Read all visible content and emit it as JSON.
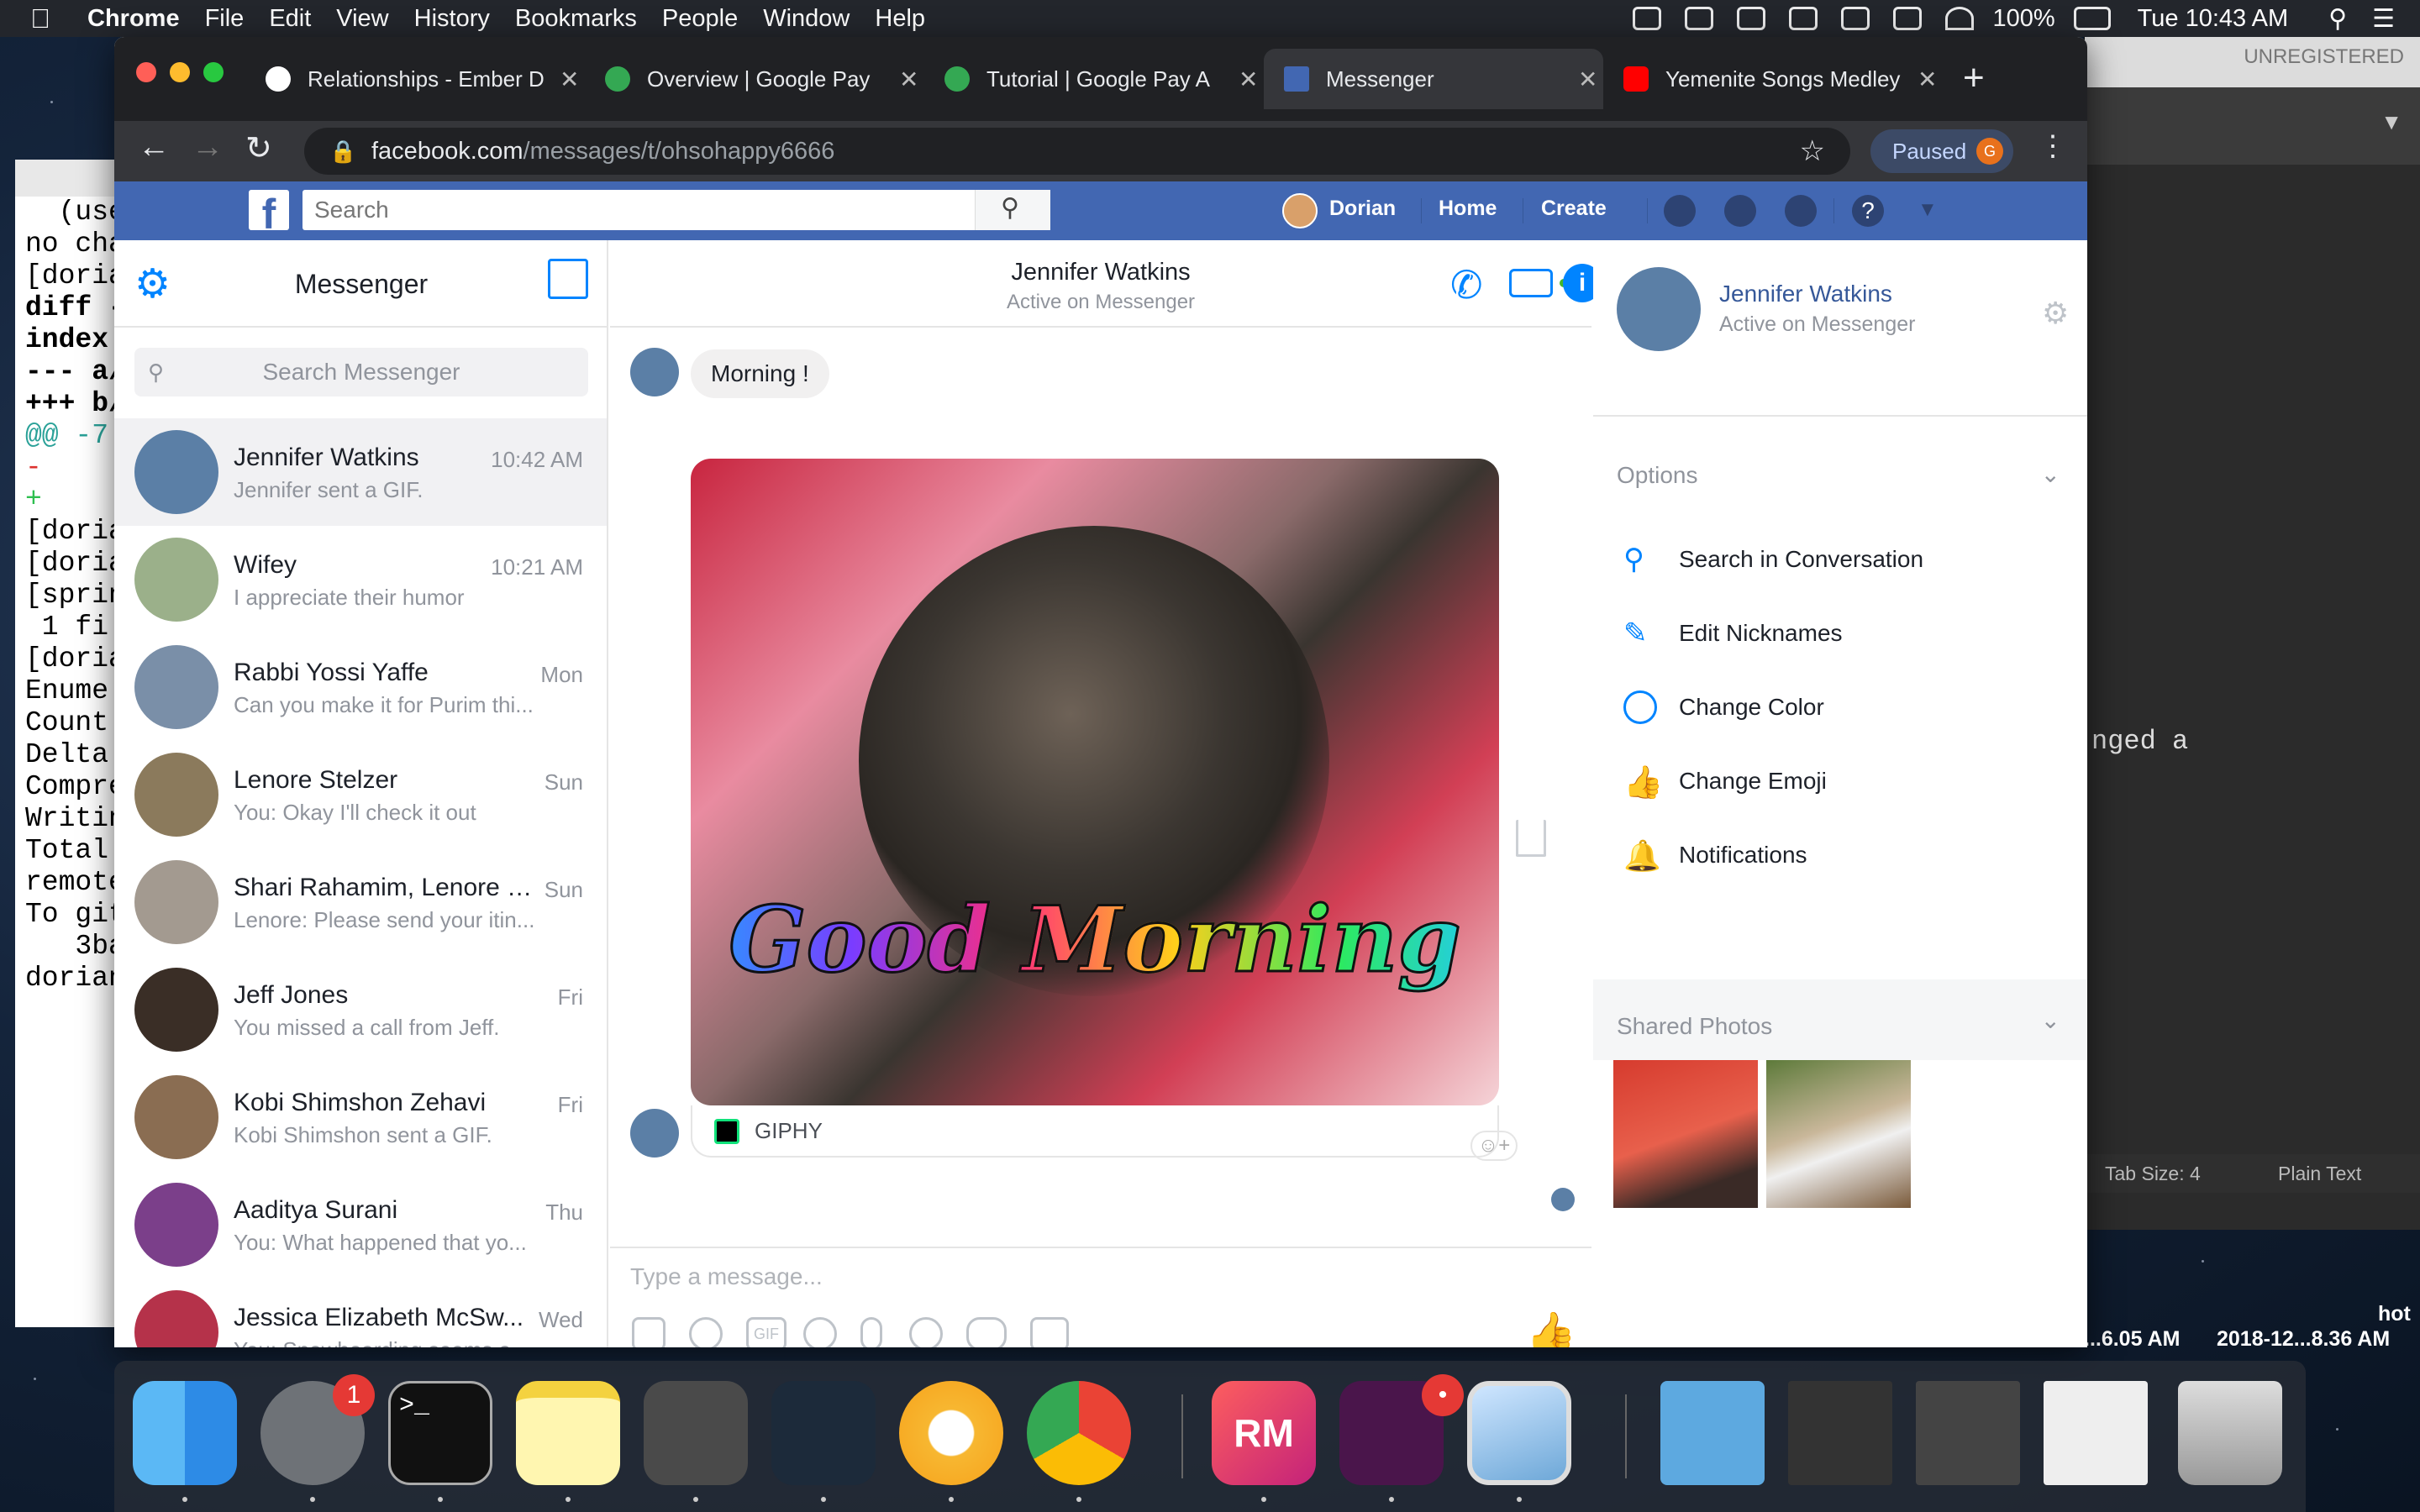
{
  "menubar": {
    "app": "Chrome",
    "items": [
      "File",
      "Edit",
      "View",
      "History",
      "Bookmarks",
      "People",
      "Window",
      "Help"
    ],
    "battery": "100%",
    "clock": "Tue 10:43 AM"
  },
  "terminal": {
    "lines": [
      "  (use",
      "",
      "",
      "no cha",
      "[doria",
      "diff -",
      "index ",
      "--- a/",
      "+++ b/",
      "@@ -7",
      "",
      "",
      "",
      "-",
      "+",
      "",
      "",
      "[dorian",
      "[dorian",
      "[sprin",
      " 1 fi",
      "[dorian",
      "Enume",
      "Count",
      "Delta",
      "Compre",
      "Writin",
      "Total",
      "remote",
      "To git",
      "   3ba",
      "dorian"
    ]
  },
  "sublime": {
    "unregistered": "UNREGISTERED",
    "fragment": "nged a",
    "tab_size": "Tab Size: 4",
    "syntax": "Plain Text"
  },
  "shot_labels": [
    "...6.05 AM",
    "2018-12...8.36 AM"
  ],
  "shot_label_top": "hot",
  "chrome": {
    "tabs": [
      {
        "title": "Relationships - Ember D",
        "color": "#ffffff"
      },
      {
        "title": "Overview  |  Google Pay",
        "color": "#34a853"
      },
      {
        "title": "Tutorial  |  Google Pay A",
        "color": "#34a853"
      },
      {
        "title": "Messenger",
        "color": "#4267b2"
      },
      {
        "title": "Yemenite Songs Medley",
        "color": "#ff0000"
      }
    ],
    "url_host": "facebook.com",
    "url_path": "/messages/t/ohsohappy6666",
    "profile_status": "Paused",
    "profile_initial": "G"
  },
  "facebook": {
    "logo": "f",
    "search_placeholder": "Search",
    "user": "Dorian",
    "home": "Home",
    "create": "Create"
  },
  "messenger": {
    "title": "Messenger",
    "search_placeholder": "Search Messenger",
    "conversations": [
      {
        "name": "Jennifer Watkins",
        "snippet": "Jennifer sent a GIF.",
        "time": "10:42 AM",
        "color": "#5b7fa6"
      },
      {
        "name": "Wifey",
        "snippet": "I appreciate their humor",
        "time": "10:21 AM",
        "color": "#9bb08a"
      },
      {
        "name": "Rabbi Yossi Yaffe",
        "snippet": "Can you make it for Purim thi...",
        "time": "Mon",
        "color": "#7a8fa8"
      },
      {
        "name": "Lenore Stelzer",
        "snippet": "You: Okay I'll check it out",
        "time": "Sun",
        "color": "#8b7a5c"
      },
      {
        "name": "Shari Rahamim, Lenore S...",
        "snippet": "Lenore: Please send your itin...",
        "time": "Sun",
        "color": "#a39a90"
      },
      {
        "name": "Jeff Jones",
        "snippet": "You missed a call from Jeff.",
        "time": "Fri",
        "color": "#3a2e26"
      },
      {
        "name": "Kobi Shimshon Zehavi",
        "snippet": "Kobi Shimshon sent a GIF.",
        "time": "Fri",
        "color": "#8a6d52"
      },
      {
        "name": "Aaditya Surani",
        "snippet": "You: What happened that yo...",
        "time": "Thu",
        "color": "#7b3f8a"
      },
      {
        "name": "Jessica Elizabeth McSw...",
        "snippet": "You: Snowboarding seems a...",
        "time": "Wed",
        "color": "#b5324a"
      }
    ],
    "chat": {
      "name": "Jennifer Watkins",
      "status": "Active on Messenger",
      "message": "Morning !",
      "gif_text": "Good Morning",
      "gif_source": "GIPHY",
      "composer_placeholder": "Type a message..."
    },
    "info": {
      "name": "Jennifer Watkins",
      "status": "Active on Messenger",
      "options_header": "Options",
      "options": [
        "Search in Conversation",
        "Edit Nicknames",
        "Change Color",
        "Change Emoji",
        "Notifications"
      ],
      "shared_header": "Shared Photos"
    }
  },
  "dock": {
    "settings_badge": "1",
    "slack_badge": "•"
  }
}
